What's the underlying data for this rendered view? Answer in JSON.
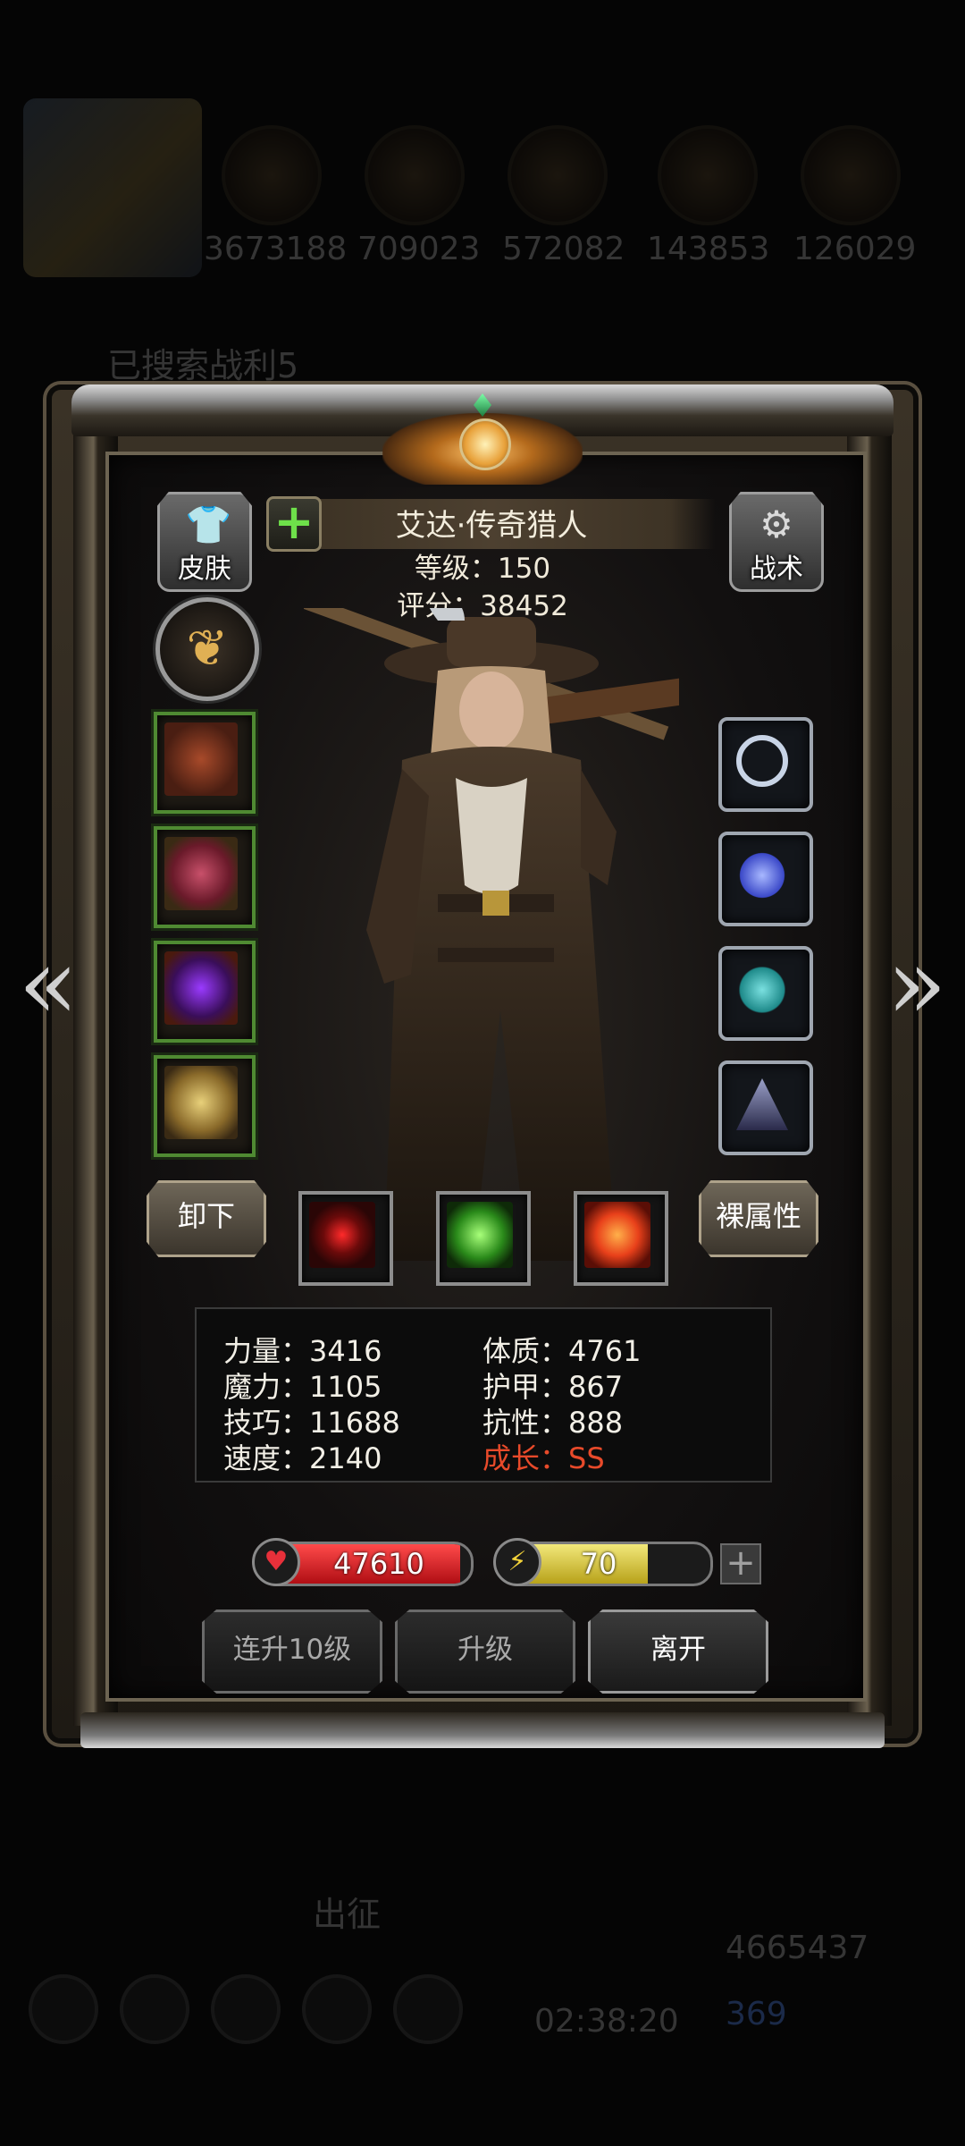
{
  "background_hud": {
    "resources": [
      "3673188",
      "709023",
      "572082",
      "143853",
      "126029"
    ],
    "obscured_text": "已搜索战利5",
    "expedition": "出征",
    "timer": "02:38:20",
    "gold": "4665437",
    "gems": "369"
  },
  "hero": {
    "name": "艾达·传奇猎人",
    "level_text": "等级：150",
    "score_text": "评分：38452"
  },
  "buttons": {
    "skin": "皮肤",
    "tactics": "战术",
    "unequip": "卸下",
    "base_attr": "裸属性",
    "level_up_10": "连升10级",
    "level_up": "升级",
    "leave": "离开"
  },
  "stats": {
    "strength": "力量：3416",
    "physique": "体质：4761",
    "magic": "魔力：1105",
    "armor": "护甲：867",
    "skill": "技巧：11688",
    "resistance": "抗性：888",
    "speed": "速度：2140",
    "growth": "成长：SS"
  },
  "hp": {
    "value": "47610",
    "fill": 0.95
  },
  "energy": {
    "value": "70",
    "fill": 0.7
  },
  "colors": {
    "growth_red": "#e84a2a",
    "hp_red": "#c8141a",
    "energy_yellow": "#e6d23a",
    "equip_green": "#4f8a32"
  },
  "icons": {
    "equipment": [
      "pistol-icon",
      "red-armor-icon",
      "purple-crown-icon",
      "gold-shield-icon"
    ],
    "gems": [
      "silver-tiara-icon",
      "blue-crystal-icon",
      "teal-stone-icon",
      "dark-pyramid-icon"
    ],
    "skills": [
      "red-target-icon",
      "green-skull-icon",
      "red-cross-icon"
    ]
  }
}
